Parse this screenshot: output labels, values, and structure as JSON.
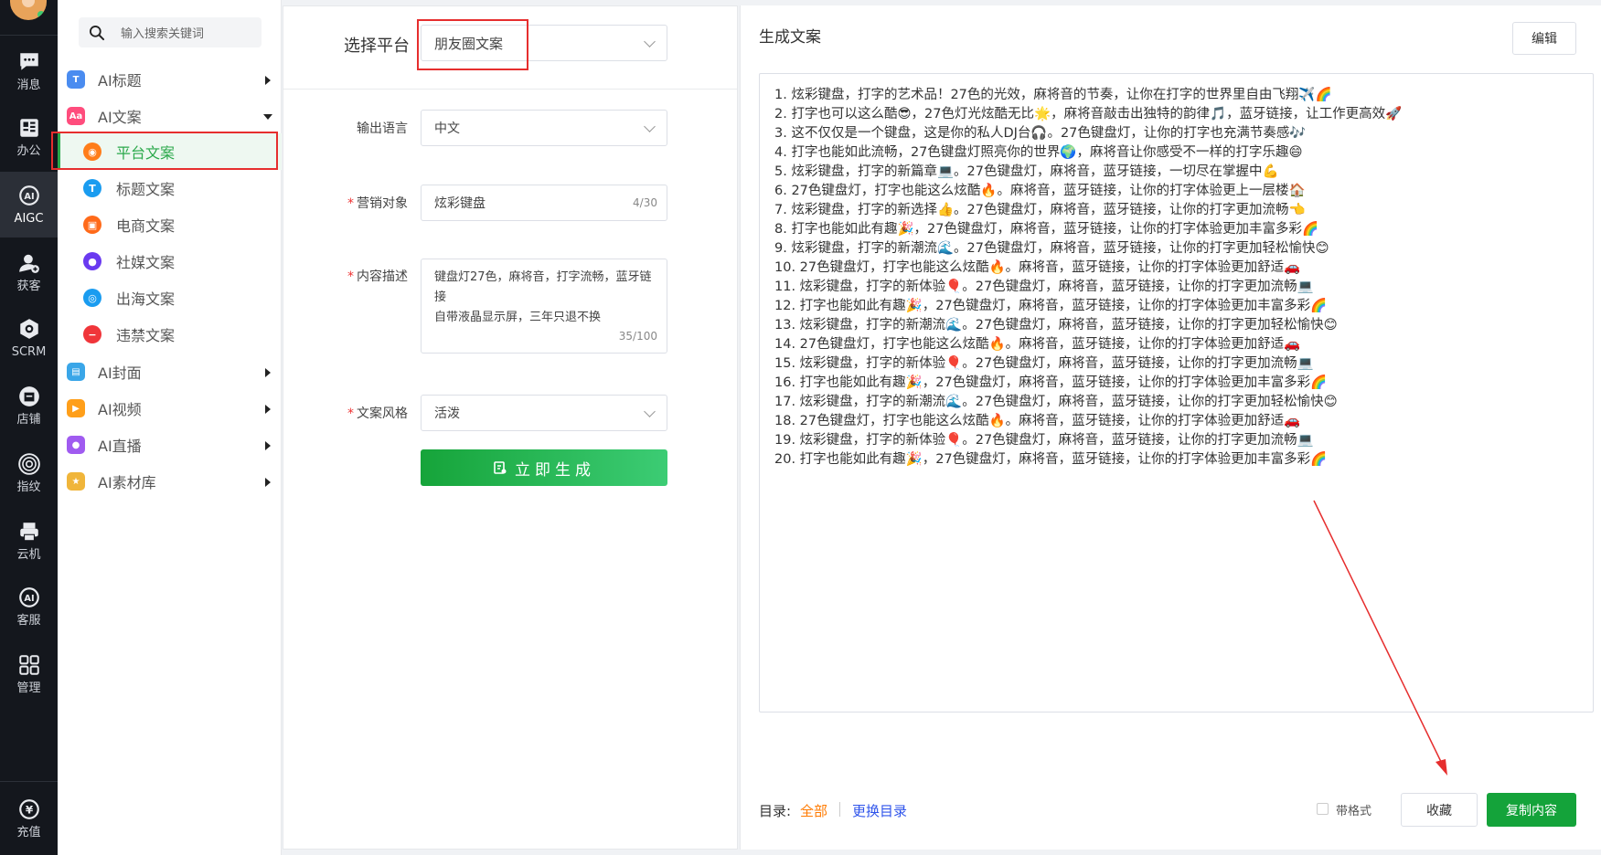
{
  "rail": {
    "items": [
      {
        "label": "消息",
        "icon": "chat-icon"
      },
      {
        "label": "办公",
        "icon": "office-icon"
      },
      {
        "label": "AIGC",
        "icon": "ai-icon"
      },
      {
        "label": "获客",
        "icon": "user-add-icon"
      },
      {
        "label": "SCRM",
        "icon": "scrm-icon"
      },
      {
        "label": "店铺",
        "icon": "shop-icon"
      },
      {
        "label": "指纹",
        "icon": "fingerprint-icon"
      },
      {
        "label": "云机",
        "icon": "cloud-phone-icon"
      },
      {
        "label": "客服",
        "icon": "support-icon"
      },
      {
        "label": "管理",
        "icon": "grid-icon"
      }
    ],
    "recharge_label": "充值"
  },
  "sidebar": {
    "search_placeholder": "输入搜索关键词",
    "menu": [
      {
        "label": "AI标题",
        "color": "#4a8cf0"
      },
      {
        "label": "AI文案",
        "color": "#ff4d7d"
      },
      {
        "label": "AI封面",
        "color": "#3aa6e8"
      },
      {
        "label": "AI视频",
        "color": "#ff9f1a"
      },
      {
        "label": "AI直播",
        "color": "#a05bf0"
      },
      {
        "label": "AI素材库",
        "color": "#f0b53a"
      }
    ],
    "submenu": [
      {
        "label": "平台文案",
        "color": "#ff7d1a"
      },
      {
        "label": "标题文案",
        "color": "#1a9cf0"
      },
      {
        "label": "电商文案",
        "color": "#ff6a1a"
      },
      {
        "label": "社媒文案",
        "color": "#6a3af0"
      },
      {
        "label": "出海文案",
        "color": "#1a9cf0"
      },
      {
        "label": "违禁文案",
        "color": "#f0353a"
      }
    ]
  },
  "form": {
    "platform_label": "选择平台",
    "platform_value": "朋友圈文案",
    "language_label": "输出语言",
    "language_value": "中文",
    "target_label": "营销对象",
    "target_value": "炫彩键盘",
    "target_count": "4/30",
    "desc_label": "内容描述",
    "desc_line1": "键盘灯27色，麻将音，打字流畅，蓝牙链接",
    "desc_line2": "自带液晶显示屏，三年只退不换",
    "desc_count": "35/100",
    "style_label": "文案风格",
    "style_value": "活泼",
    "generate_label": "立即生成"
  },
  "result": {
    "title": "生成文案",
    "edit_label": "编辑",
    "lines": [
      "1. 炫彩键盘，打字的艺术品！27色的光效，麻将音的节奏，让你在打字的世界里自由飞翔✈️🌈",
      "2. 打字也可以这么酷😎，27色灯光炫酷无比🌟，麻将音敲击出独特的韵律🎵，蓝牙链接，让工作更高效🚀",
      "3. 这不仅仅是一个键盘，这是你的私人DJ台🎧。27色键盘灯，让你的打字也充满节奏感🎶",
      "4. 打字也能如此流畅，27色键盘灯照亮你的世界🌍，麻将音让你感受不一样的打字乐趣😄",
      "5. 炫彩键盘，打字的新篇章💻。27色键盘灯，麻将音，蓝牙链接，一切尽在掌握中💪",
      "6. 27色键盘灯，打字也能这么炫酷🔥。麻将音，蓝牙链接，让你的打字体验更上一层楼🏠",
      "7. 炫彩键盘，打字的新选择👍。27色键盘灯，麻将音，蓝牙链接，让你的打字更加流畅👈",
      "8. 打字也能如此有趣🎉，27色键盘灯，麻将音，蓝牙链接，让你的打字体验更加丰富多彩🌈",
      "9. 炫彩键盘，打字的新潮流🌊。27色键盘灯，麻将音，蓝牙链接，让你的打字更加轻松愉快😊",
      "10. 27色键盘灯，打字也能这么炫酷🔥。麻将音，蓝牙链接，让你的打字体验更加舒适🚗",
      "11. 炫彩键盘，打字的新体验🎈。27色键盘灯，麻将音，蓝牙链接，让你的打字更加流畅💻",
      "12. 打字也能如此有趣🎉，27色键盘灯，麻将音，蓝牙链接，让你的打字体验更加丰富多彩🌈",
      "13. 炫彩键盘，打字的新潮流🌊。27色键盘灯，麻将音，蓝牙链接，让你的打字更加轻松愉快😊",
      "14. 27色键盘灯，打字也能这么炫酷🔥。麻将音，蓝牙链接，让你的打字体验更加舒适🚗",
      "15. 炫彩键盘，打字的新体验🎈。27色键盘灯，麻将音，蓝牙链接，让你的打字更加流畅💻",
      "16. 打字也能如此有趣🎉，27色键盘灯，麻将音，蓝牙链接，让你的打字体验更加丰富多彩🌈",
      "17. 炫彩键盘，打字的新潮流🌊。27色键盘灯，麻将音，蓝牙链接，让你的打字更加轻松愉快😊",
      "18. 27色键盘灯，打字也能这么炫酷🔥。麻将音，蓝牙链接，让你的打字体验更加舒适🚗",
      "19. 炫彩键盘，打字的新体验🎈。27色键盘灯，麻将音，蓝牙链接，让你的打字更加流畅💻",
      "20. 打字也能如此有趣🎉，27色键盘灯，麻将音，蓝牙链接，让你的打字体验更加丰富多彩🌈"
    ],
    "dir_label": "目录:",
    "dir_all": "全部",
    "dir_change": "更换目录",
    "format_label": "带格式",
    "fav_label": "收藏",
    "copy_label": "复制内容"
  },
  "colors": {
    "accent_green": "#14a33a",
    "highlight_red": "#e62e2e",
    "link_orange": "#ff7a00",
    "link_blue": "#2f54eb"
  }
}
